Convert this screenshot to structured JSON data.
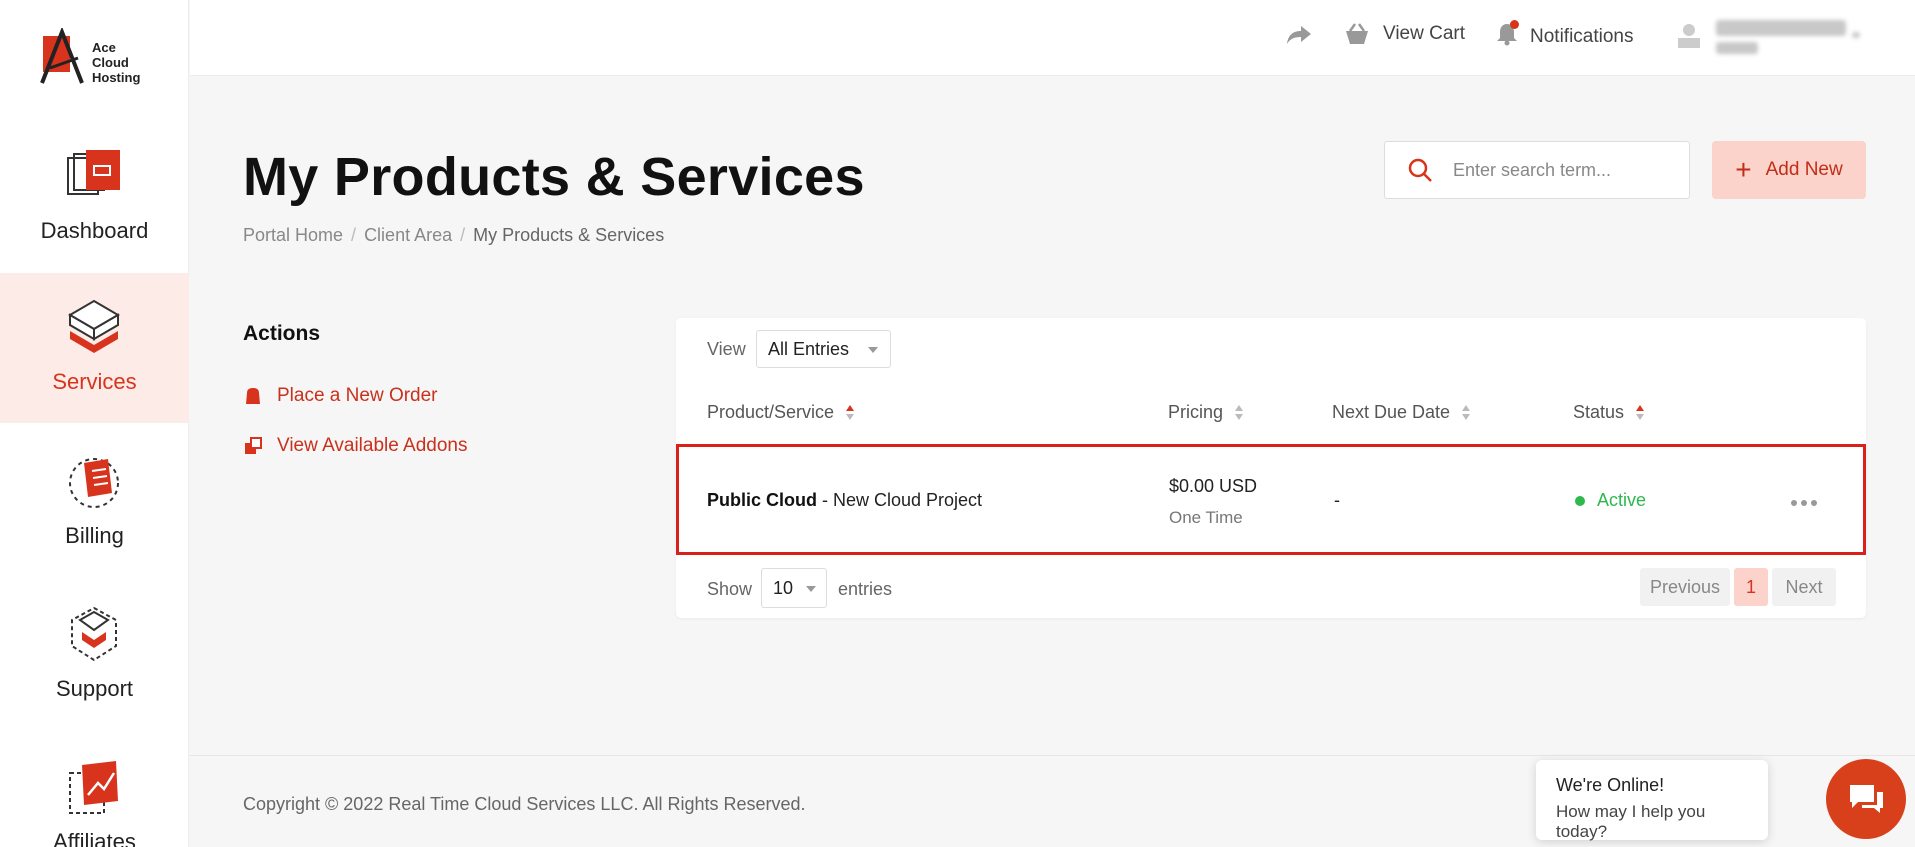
{
  "brand": {
    "logo_text": [
      "Ace",
      "Cloud",
      "Hosting"
    ],
    "accent_color": "#d8341d"
  },
  "sidebar": {
    "items": [
      {
        "label": "Dashboard",
        "icon": "dashboard-icon",
        "active": false
      },
      {
        "label": "Services",
        "icon": "services-icon",
        "active": true
      },
      {
        "label": "Billing",
        "icon": "billing-icon",
        "active": false
      },
      {
        "label": "Support",
        "icon": "support-icon",
        "active": false
      },
      {
        "label": "Affiliates",
        "icon": "affiliates-icon",
        "active": false
      }
    ]
  },
  "topbar": {
    "share_icon": "share-icon",
    "cart_label": "View Cart",
    "notifications_label": "Notifications"
  },
  "page": {
    "title": "My Products & Services",
    "breadcrumb": [
      "Portal Home",
      "Client Area",
      "My Products & Services"
    ]
  },
  "search": {
    "placeholder": "Enter search term..."
  },
  "add_new_label": "Add New",
  "actions": {
    "title": "Actions",
    "items": [
      {
        "label": "Place a New Order",
        "icon": "cart-icon"
      },
      {
        "label": "View Available Addons",
        "icon": "addons-icon"
      }
    ]
  },
  "table": {
    "view_label": "View",
    "view_value": "All Entries",
    "columns": [
      "Product/Service",
      "Pricing",
      "Next Due Date",
      "Status"
    ],
    "rows": [
      {
        "product": "Public Cloud",
        "project": " - New Cloud Project",
        "price": "$0.00 USD",
        "cycle": "One Time",
        "due": "-",
        "status": "Active",
        "status_color": "#2eb84d"
      }
    ],
    "show_label": "Show",
    "page_size": "10",
    "entries_label": "entries",
    "pagination": {
      "previous": "Previous",
      "current": "1",
      "next": "Next"
    }
  },
  "footer": {
    "copyright": "Copyright © 2022 Real Time Cloud Services LLC. All Rights Reserved."
  },
  "chat": {
    "line1": "We're Online!",
    "line2": "How may I help you today?"
  }
}
